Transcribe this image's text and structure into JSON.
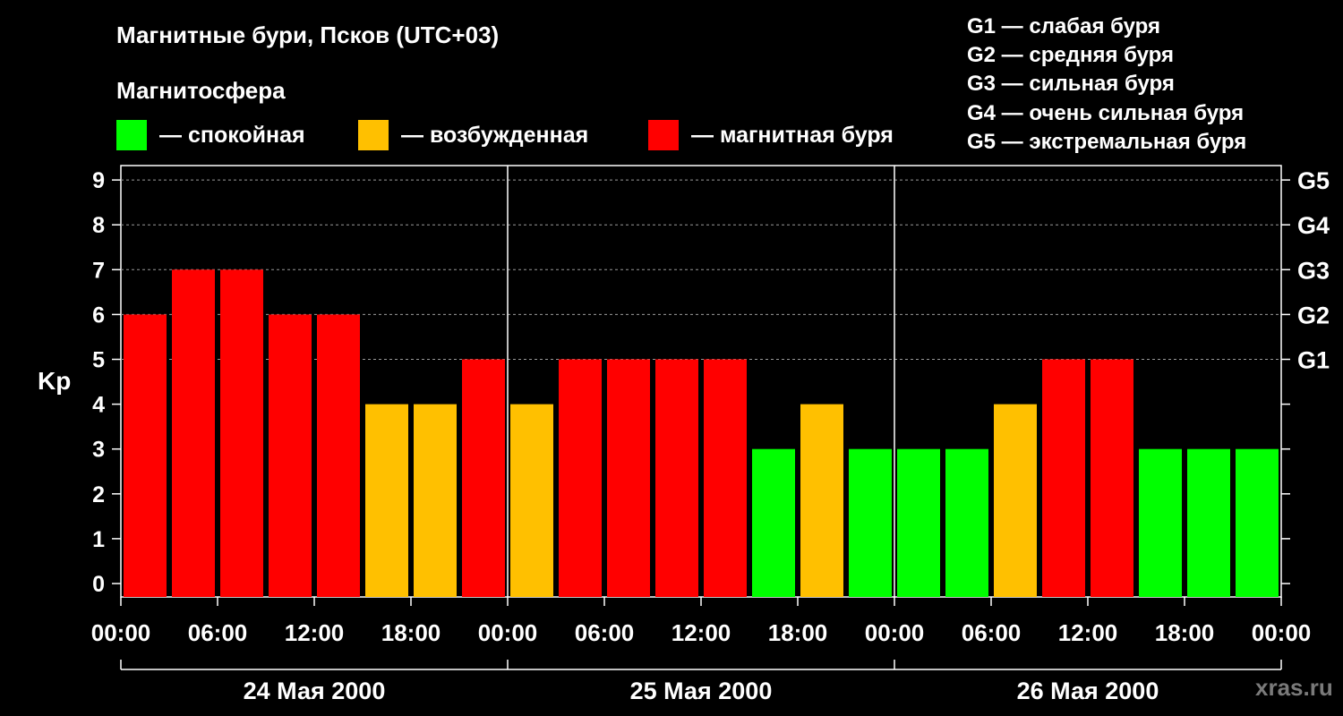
{
  "title": "Магнитные бури, Псков (UTC+03)",
  "magnetosphere_title": "Магнитосфера",
  "legend": [
    {
      "label": "— спокойная",
      "color": "#00ff00"
    },
    {
      "label": "— возбужденная",
      "color": "#ffc000"
    },
    {
      "label": "— магнитная буря",
      "color": "#ff0000"
    }
  ],
  "g_legend": [
    "G1 — слабая буря",
    "G2 — средняя буря",
    "G3 — сильная буря",
    "G4 — очень сильная буря",
    "G5 — экстремальная буря"
  ],
  "watermark": "xras.ru",
  "chart_data": {
    "type": "bar",
    "ylabel": "Kp",
    "ylim": [
      0,
      9
    ],
    "yticks": [
      "0",
      "1",
      "2",
      "3",
      "4",
      "5",
      "6",
      "7",
      "8",
      "9"
    ],
    "g_ticks": [
      {
        "value": 5,
        "label": "G1"
      },
      {
        "value": 6,
        "label": "G2"
      },
      {
        "value": 7,
        "label": "G3"
      },
      {
        "value": 8,
        "label": "G4"
      },
      {
        "value": 9,
        "label": "G5"
      }
    ],
    "xtick_labels": [
      "00:00",
      "06:00",
      "12:00",
      "18:00",
      "00:00",
      "06:00",
      "12:00",
      "18:00",
      "00:00",
      "06:00",
      "12:00",
      "18:00",
      "00:00"
    ],
    "days": [
      "24 Мая 2000",
      "25 Мая 2000",
      "26 Мая 2000"
    ],
    "values": [
      6,
      7,
      7,
      6,
      6,
      4,
      4,
      5,
      4,
      5,
      5,
      5,
      5,
      3,
      4,
      3,
      3,
      3,
      4,
      5,
      5,
      3,
      3,
      3
    ],
    "colors": {
      "quiet": "#00ff00",
      "active": "#ffc000",
      "storm": "#ff0000"
    },
    "grid": "dashed at Kp 5–9"
  }
}
